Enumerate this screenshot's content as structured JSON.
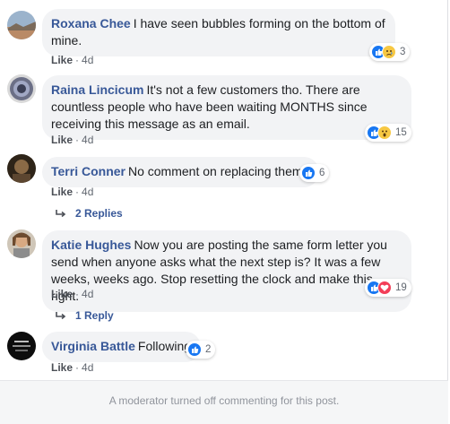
{
  "comments": [
    {
      "author": "Roxana Chee",
      "text": "I have seen bubbles forming on the bottom of mine.",
      "reaction_count": "3",
      "reactions": [
        "like-icon",
        "sad-icon"
      ],
      "like_label": "Like",
      "age": "4d"
    },
    {
      "author": "Raina Lincicum",
      "text": "It's not a few customers tho. There are countless people who have been waiting MONTHS since receiving this message as an email.",
      "reaction_count": "15",
      "reactions": [
        "like-icon",
        "wow-icon"
      ],
      "like_label": "Like",
      "age": "4d"
    },
    {
      "author": "Terri Conner",
      "text": "No comment on replacing them?",
      "reaction_count": "6",
      "reactions": [
        "like-icon"
      ],
      "like_label": "Like",
      "age": "4d",
      "replies_label": "2 Replies"
    },
    {
      "author": "Katie Hughes",
      "text": "Now you are posting the same form letter you send when anyone asks what the next step is? It was a few weeks, weeks ago. Stop resetting the clock and make this right.",
      "reaction_count": "19",
      "reactions": [
        "like-icon",
        "love-icon"
      ],
      "like_label": "Like",
      "age": "4d",
      "replies_label": "1 Reply"
    },
    {
      "author": "Virginia Battle",
      "text": "Following",
      "reaction_count": "2",
      "reactions": [
        "like-icon"
      ],
      "like_label": "Like",
      "age": "4d"
    }
  ],
  "footer_text": "A moderator turned off commenting for this post.",
  "colors": {
    "author": "#385898",
    "bubble": "#f2f3f5",
    "like": "#1877f2",
    "love": "#f33e58",
    "yellow": "#f7c843"
  }
}
